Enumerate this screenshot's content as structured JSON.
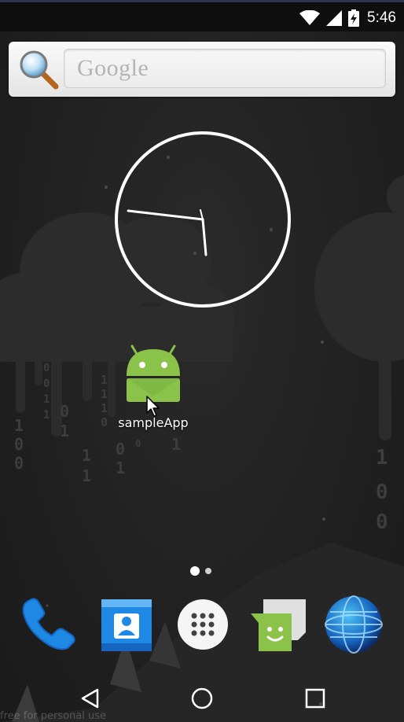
{
  "status_bar": {
    "time": "5:46",
    "icons": [
      "wifi-icon",
      "cell-signal-icon",
      "battery-charging-icon"
    ]
  },
  "search_widget": {
    "icon": "search-icon",
    "placeholder": "Google"
  },
  "clock_widget": {
    "type": "analog-clock",
    "hour": 5,
    "minute": 46
  },
  "home_screen": {
    "apps": [
      {
        "label": "sampleApp",
        "icon": "android-robot-icon"
      }
    ],
    "pages": 2,
    "current_page": 1
  },
  "dock": {
    "items": [
      {
        "name": "phone",
        "icon": "phone-icon"
      },
      {
        "name": "contacts",
        "icon": "contacts-icon"
      },
      {
        "name": "app-drawer",
        "icon": "apps-grid-icon"
      },
      {
        "name": "messaging",
        "icon": "messaging-icon"
      },
      {
        "name": "browser",
        "icon": "globe-icon"
      }
    ]
  },
  "nav_bar": {
    "buttons": [
      "back-icon",
      "home-icon",
      "recents-icon"
    ]
  },
  "watermark": "free for personal use",
  "colors": {
    "background": "#212121",
    "status_bar": "#0f0f0f",
    "android_green": "#8bc34a",
    "phone_blue": "#1e88e5"
  }
}
